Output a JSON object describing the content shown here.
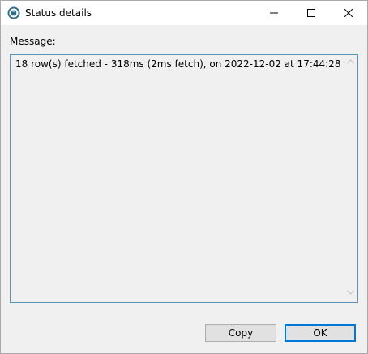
{
  "window": {
    "title": "Status details",
    "app_icon": "database-icon"
  },
  "controls": {
    "minimize_icon": "minimize-icon",
    "maximize_icon": "maximize-icon",
    "close_icon": "close-icon"
  },
  "message": {
    "label": "Message:",
    "text": "18 row(s) fetched - 318ms (2ms fetch), on 2022-12-02 at 17:44:28"
  },
  "buttons": {
    "copy_label": "Copy",
    "ok_label": "OK"
  },
  "colors": {
    "focus_border": "#0078d7",
    "textbox_border": "#5a94b4",
    "background": "#f0f0f0"
  }
}
